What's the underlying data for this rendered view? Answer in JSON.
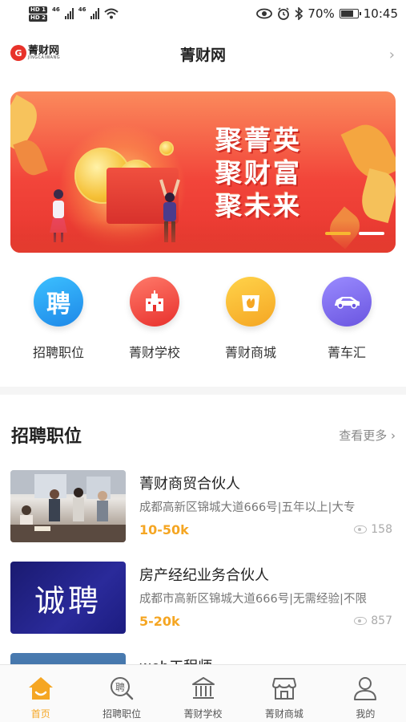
{
  "status_bar": {
    "sim1": "HD 1",
    "sim2": "HD 2",
    "net1": "46",
    "net2": "46",
    "battery": "70%",
    "time": "10:45"
  },
  "header": {
    "logo_cn": "菁财网",
    "logo_en": "JINGCAIWANG",
    "title": "菁财网"
  },
  "banner": {
    "slogan": [
      "聚菁英",
      "聚财富",
      "聚未来"
    ],
    "active_slide": 2,
    "slide_count": 2
  },
  "quick_nav": [
    {
      "label": "招聘职位",
      "icon": "recruit-icon",
      "glyph": "聘",
      "color": "#1e9af0"
    },
    {
      "label": "菁财学校",
      "icon": "school-icon",
      "glyph": "",
      "color": "#f0443c"
    },
    {
      "label": "菁财商城",
      "icon": "mall-icon",
      "glyph": "",
      "color": "#f7b731"
    },
    {
      "label": "菁车汇",
      "icon": "car-icon",
      "glyph": "",
      "color": "#7464e8"
    }
  ],
  "jobs_section": {
    "title": "招聘职位",
    "more": "查看更多"
  },
  "jobs": [
    {
      "title": "菁财商贸合伙人",
      "address": "成都高新区锦城大道666号|五年以上|大专",
      "salary": "10-50k",
      "views": "158",
      "image": "meeting-photo"
    },
    {
      "title": "房产经纪业务合伙人",
      "address": "成都市高新区锦城大道666号|无需经验|不限",
      "salary": "5-20k",
      "views": "857",
      "image": "recruit-banner",
      "image_text": "诚聘"
    },
    {
      "title": "web工程师",
      "address": "",
      "salary": "",
      "views": "",
      "image": "office-photo"
    }
  ],
  "tabbar": [
    {
      "label": "首页",
      "icon": "home-icon",
      "active": true
    },
    {
      "label": "招聘职位",
      "icon": "recruit-search-icon",
      "active": false
    },
    {
      "label": "菁财学校",
      "icon": "school-building-icon",
      "active": false
    },
    {
      "label": "菁财商城",
      "icon": "store-icon",
      "active": false
    },
    {
      "label": "我的",
      "icon": "user-icon",
      "active": false
    }
  ],
  "colors": {
    "accent": "#f5a623",
    "banner_red": "#f2453a"
  }
}
